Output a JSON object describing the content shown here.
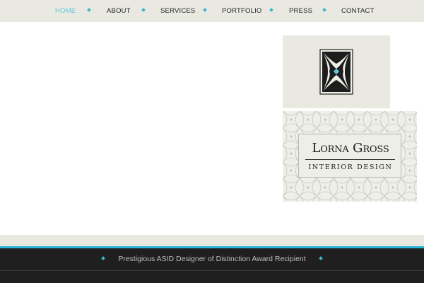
{
  "nav": {
    "items": [
      {
        "label": "HOME",
        "active": true
      },
      {
        "label": "ABOUT",
        "active": false
      },
      {
        "label": "SERVICES",
        "active": false
      },
      {
        "label": "PORTFOLIO",
        "active": false
      },
      {
        "label": "PRESS",
        "active": false
      },
      {
        "label": "CONTACT",
        "active": false
      }
    ],
    "separator_icon": "diamond-icon"
  },
  "logo": {
    "icon": "ornamental-x-emblem",
    "name": "Lorna Gross",
    "tagline": "Interior Design"
  },
  "footer": {
    "award_text": "Prestigious ASID Designer of Distinction Award Recipient"
  },
  "colors": {
    "accent": "#3ab7d6",
    "nav_active": "#5ec6dc",
    "band": "#e9e9e2",
    "footer_bg": "#1f1f1f"
  }
}
